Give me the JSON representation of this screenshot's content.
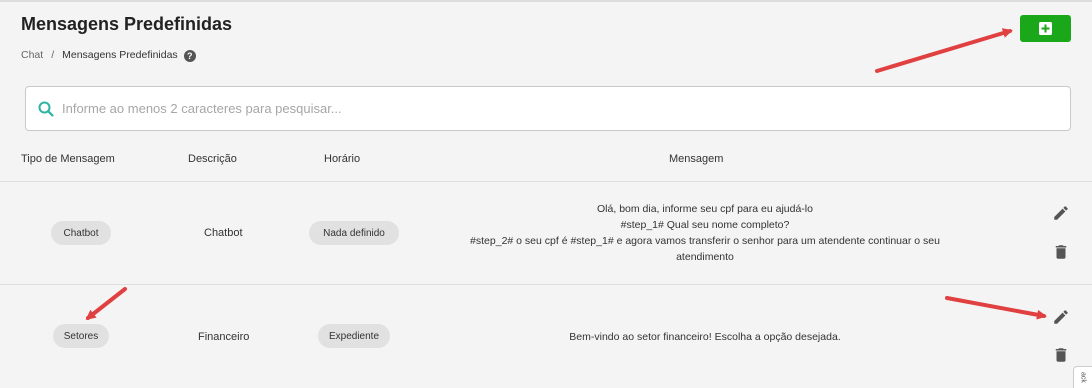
{
  "header": {
    "title": "Mensagens Predefinidas",
    "add_button_icon": "plus-square-icon"
  },
  "breadcrumb": {
    "items": [
      "Chat",
      "Mensagens Predefinidas"
    ],
    "separator": "/",
    "help_icon": "question-circle-icon",
    "help_glyph": "?"
  },
  "search": {
    "placeholder": "Informe ao menos 2 caracteres para pesquisar...",
    "value": "",
    "icon": "search-icon"
  },
  "table": {
    "columns": [
      "Tipo de Mensagem",
      "Descrição",
      "Horário",
      "Mensagem"
    ],
    "rows": [
      {
        "tipo": "Chatbot",
        "descricao": "Chatbot",
        "horario": "Nada definido",
        "mensagem": [
          "Olá, bom dia, informe seu cpf para eu ajudá-lo",
          "#step_1# Qual seu nome completo?",
          "#step_2# o seu cpf é #step_1# e agora vamos transferir o senhor para um atendente continuar o seu",
          "atendimento"
        ]
      },
      {
        "tipo": "Setores",
        "descricao": "Financeiro",
        "horario": "Expediente",
        "mensagem": [
          "Bem-vindo ao setor financeiro! Escolha a opção desejada."
        ]
      }
    ],
    "actions": [
      "edit-icon",
      "trash-icon"
    ]
  },
  "edge_tab": {
    "label": "ack"
  },
  "colors": {
    "accent_green": "#1aa81a",
    "search_teal": "#2cb3a3",
    "annotation_red": "#e04040",
    "chip_bg": "#e1e1e1"
  }
}
